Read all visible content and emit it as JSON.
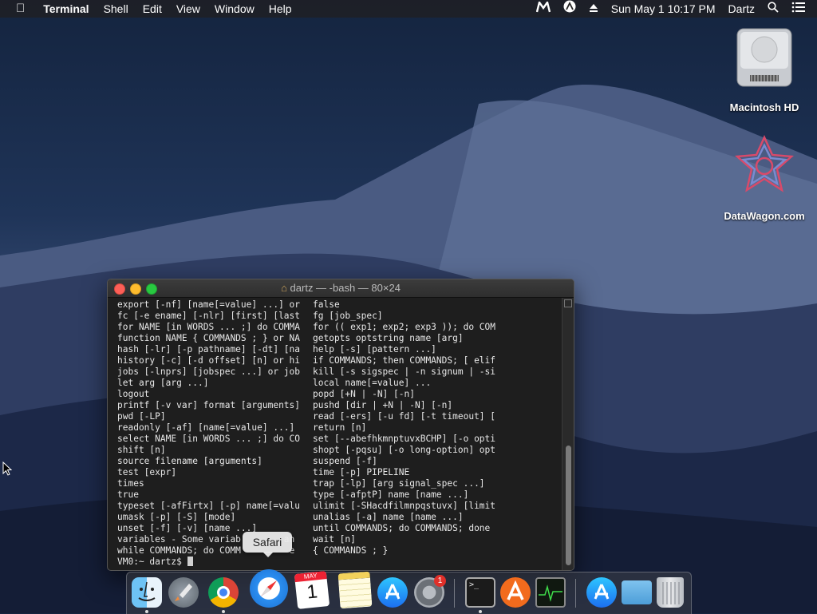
{
  "menubar": {
    "apple": "",
    "app": "Terminal",
    "items": [
      "Shell",
      "Edit",
      "View",
      "Window",
      "Help"
    ],
    "clock": "Sun May 1  10:17 PM",
    "user": "Dartz"
  },
  "desktop": {
    "icons": [
      {
        "label": "Macintosh HD"
      },
      {
        "label": "DataWagon.com"
      }
    ]
  },
  "terminal": {
    "title": "dartz — -bash — 80×24",
    "rows": [
      [
        "export [-nf] [name[=value] ...] or",
        "false"
      ],
      [
        "fc [-e ename] [-nlr] [first] [last",
        "fg [job_spec]"
      ],
      [
        "for NAME [in WORDS ... ;] do COMMA",
        "for (( exp1; exp2; exp3 )); do COM"
      ],
      [
        "function NAME { COMMANDS ; } or NA",
        "getopts optstring name [arg]"
      ],
      [
        "hash [-lr] [-p pathname] [-dt] [na",
        "help [-s] [pattern ...]"
      ],
      [
        "history [-c] [-d offset] [n] or hi",
        "if COMMANDS; then COMMANDS; [ elif"
      ],
      [
        "jobs [-lnprs] [jobspec ...] or job",
        "kill [-s sigspec | -n signum | -si"
      ],
      [
        "let arg [arg ...]",
        "local name[=value] ..."
      ],
      [
        "logout",
        "popd [+N | -N] [-n]"
      ],
      [
        "printf [-v var] format [arguments]",
        "pushd [dir | +N | -N] [-n]"
      ],
      [
        "pwd [-LP]",
        "read [-ers] [-u fd] [-t timeout] ["
      ],
      [
        "readonly [-af] [name[=value] ...]",
        "return [n]"
      ],
      [
        "select NAME [in WORDS ... ;] do CO",
        "set [--abefhkmnptuvxBCHP] [-o opti"
      ],
      [
        "shift [n]",
        "shopt [-pqsu] [-o long-option] opt"
      ],
      [
        "source filename [arguments]",
        "suspend [-f]"
      ],
      [
        "test [expr]",
        "time [-p] PIPELINE"
      ],
      [
        "times",
        "trap [-lp] [arg signal_spec ...]"
      ],
      [
        "true",
        "type [-afptP] name [name ...]"
      ],
      [
        "typeset [-afFirtx] [-p] name[=valu",
        "ulimit [-SHacdfilmnpqstuvx] [limit"
      ],
      [
        "umask [-p] [-S] [mode]",
        "unalias [-a] name [name ...]"
      ],
      [
        "unset [-f] [-v] [name ...]",
        "until COMMANDS; do COMMANDS; done"
      ],
      [
        "variables - Some variab        an",
        "wait [n]"
      ],
      [
        "while COMMANDS; do COMM         e",
        "{ COMMANDS ; }"
      ]
    ],
    "prompt": "VM0:~ dartz$ "
  },
  "tooltip": "Safari",
  "dock": {
    "calendar_month": "MAY",
    "calendar_day": "1",
    "prefs_badge": "1",
    "terminal_glyph": ">_"
  }
}
